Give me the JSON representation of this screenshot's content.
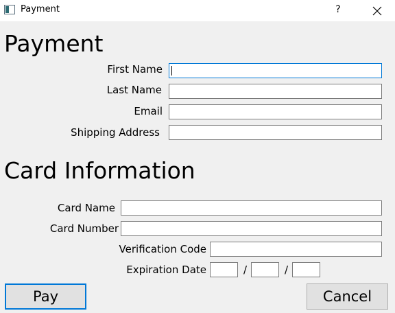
{
  "window": {
    "title": "Payment",
    "help_label": "?",
    "icon": "window-app-icon",
    "close_icon": "close-icon"
  },
  "payment": {
    "heading": "Payment",
    "first_name": {
      "label": "First Name",
      "value": ""
    },
    "last_name": {
      "label": "Last Name",
      "value": ""
    },
    "email": {
      "label": "Email",
      "value": ""
    },
    "shipping_address": {
      "label": "Shipping Address",
      "value": ""
    }
  },
  "card": {
    "heading": "Card Information",
    "card_name": {
      "label": "Card Name",
      "value": ""
    },
    "card_number": {
      "label": "Card Number",
      "value": ""
    },
    "verification_code": {
      "label": "Verification Code",
      "value": ""
    },
    "expiration": {
      "label": "Expiration Date",
      "separator": "/",
      "part1": "",
      "part2": "",
      "part3": ""
    }
  },
  "buttons": {
    "pay_label": "Pay",
    "cancel_label": "Cancel"
  },
  "colors": {
    "background": "#f0f0f0",
    "focus_accent": "#0078d7",
    "button_face": "#e1e1e1"
  }
}
